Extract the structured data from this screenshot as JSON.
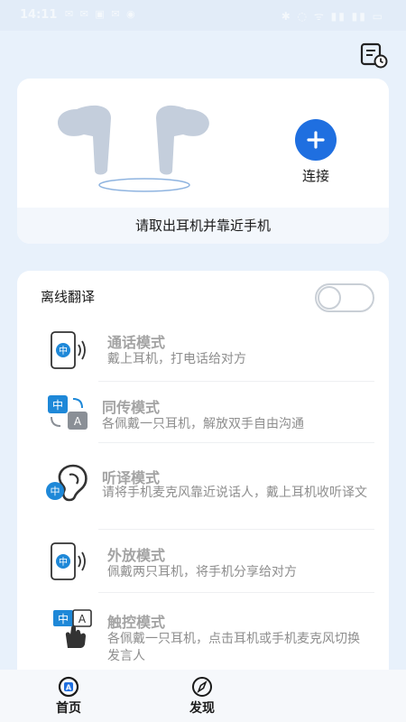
{
  "status_bar": {
    "time": "14:11",
    "left_icons": "✉ ✉ ▣ ✉ ◉",
    "right_icons": "✱ ◌ ᯤ ▮▮ ▮▮ ▭"
  },
  "header": {
    "history_icon": "history-icon"
  },
  "device": {
    "connect_label": "连接",
    "footer_text": "请取出耳机并靠近手机"
  },
  "offline": {
    "title": "离线翻译",
    "toggle_on": false,
    "modes": [
      {
        "title": "通话模式",
        "desc": "戴上耳机，打电话给对方"
      },
      {
        "title": "同传模式",
        "desc": "各佩戴一只耳机，解放双手自由沟通"
      },
      {
        "title": "听译模式",
        "desc": "请将手机麦克风靠近说话人，戴上耳机收听译文"
      },
      {
        "title": "外放模式",
        "desc": "佩戴两只耳机，将手机分享给对方"
      },
      {
        "title": "触控模式",
        "desc": "各佩戴一只耳机，点击耳机或手机麦克风切换发言人"
      }
    ],
    "icon_text_zh": "中",
    "icon_text_a": "A"
  },
  "nav": {
    "home_label": "首页",
    "discover_label": "发现"
  },
  "colors": {
    "accent": "#1f6fe0",
    "mode_icon_blue": "#1e88d8",
    "background": "#e8f1fb"
  }
}
